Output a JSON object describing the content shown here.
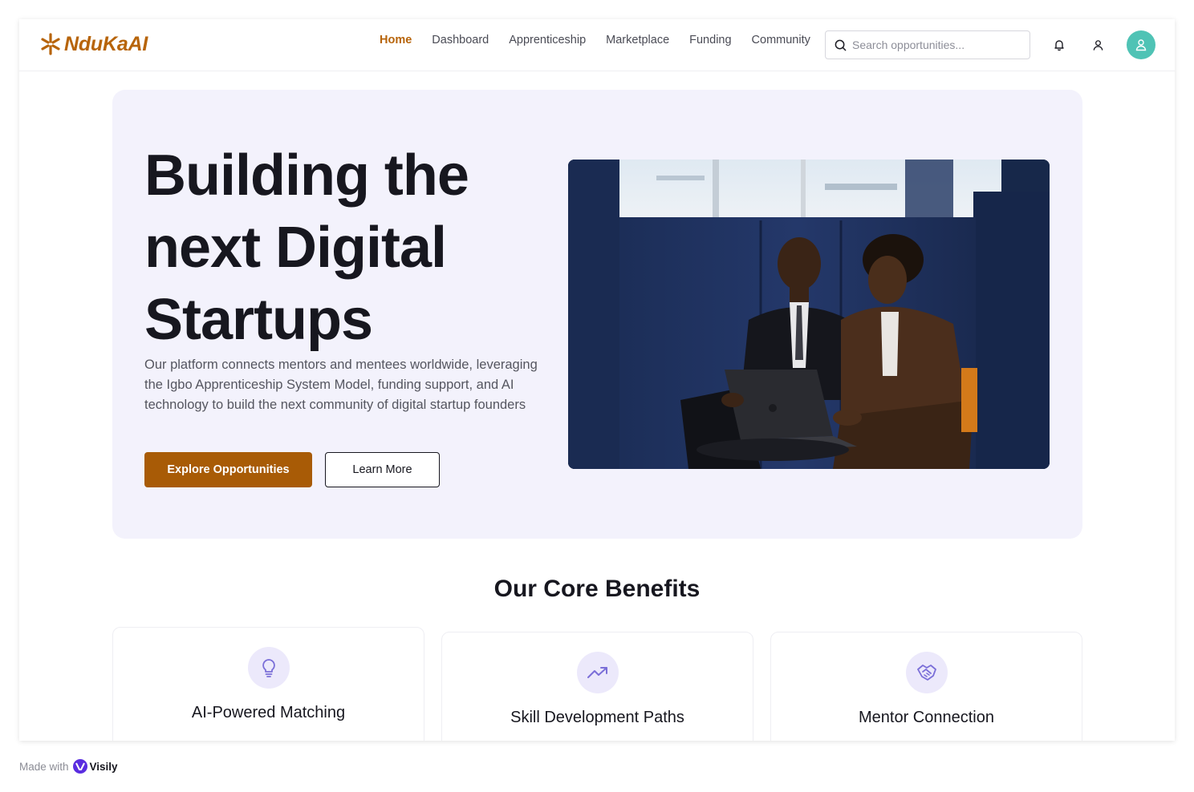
{
  "brand": {
    "name": "NduKaAI",
    "color": "#b7640a"
  },
  "nav": {
    "items": [
      {
        "label": "Home",
        "active": true
      },
      {
        "label": "Dashboard",
        "active": false
      },
      {
        "label": "Apprenticeship",
        "active": false
      },
      {
        "label": "Marketplace",
        "active": false
      },
      {
        "label": "Funding",
        "active": false
      },
      {
        "label": "Community",
        "active": false
      }
    ]
  },
  "search": {
    "placeholder": "Search opportunities...",
    "icon": "search-icon"
  },
  "header_icons": [
    "bell-icon",
    "user-icon",
    "avatar-user-icon"
  ],
  "hero": {
    "title": "Building the next Digital Startups",
    "description": "Our platform connects mentors and mentees worldwide, leveraging the Igbo Apprenticeship System Model, funding support, and AI technology to build the next community of digital startup founders",
    "primary_button": "Explore Opportunities",
    "secondary_button": "Learn More",
    "image": "Two men in suits working on a laptop in a blue office booth"
  },
  "benefits": {
    "title": "Our Core Benefits",
    "cards": [
      {
        "title": "AI-Powered Matching",
        "icon": "lightbulb-icon"
      },
      {
        "title": "Skill Development Paths",
        "icon": "trending-up-icon"
      },
      {
        "title": "Mentor Connection",
        "icon": "handshake-icon"
      }
    ]
  },
  "footer": {
    "made_with": "Made with",
    "tool": "Visily"
  },
  "colors": {
    "accent": "#a85b06",
    "hero_bg": "#f3f2fc",
    "avatar": "#4fc3b5",
    "icon_bg": "#ece9fb",
    "icon_fg": "#7b6fd8"
  }
}
